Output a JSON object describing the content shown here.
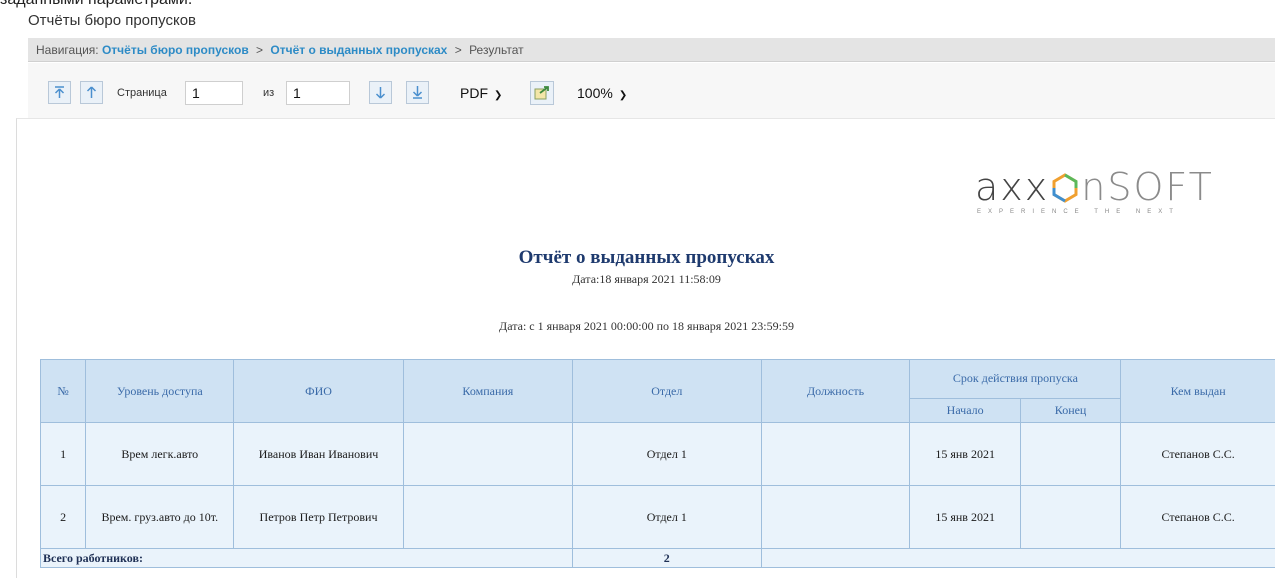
{
  "top_text": "заданными параметрами.",
  "window_title": "Отчёты бюро пропусков",
  "breadcrumb": {
    "prefix": "Навигация:",
    "items": [
      "Отчёты бюро пропусков",
      "Отчёт о выданных пропусках"
    ],
    "separator": ">",
    "current": "Результат"
  },
  "toolbar": {
    "page_label": "Страница",
    "page_value": "1",
    "of_label": "из",
    "total_pages": "1",
    "format": "PDF",
    "zoom": "100%"
  },
  "logo": {
    "brand": "axxonsoft",
    "text_part1": "axx",
    "text_part2": "nSOFT",
    "tagline": "EXPERIENCE THE NEXT"
  },
  "report": {
    "title": "Отчёт о выданных пропусках",
    "date_line": "Дата:18 января 2021 11:58:09",
    "period_line": "Дата: с 1 января 2021 00:00:00 по 18 января 2021 23:59:59",
    "columns": {
      "num": "№",
      "access_level": "Уровень доступа",
      "fio": "ФИО",
      "company": "Компания",
      "department": "Отдел",
      "position": "Должность",
      "validity": "Срок действия пропуска",
      "start": "Начало",
      "end": "Конец",
      "issued_by": "Кем выдан"
    },
    "rows": [
      {
        "num": "1",
        "access_level": "Врем легк.авто",
        "fio": "Иванов Иван Иванович",
        "company": "",
        "department": "Отдел 1",
        "position": "",
        "start": "15 янв 2021",
        "end": "",
        "issued_by": "Степанов С.С."
      },
      {
        "num": "2",
        "access_level": "Врем. груз.авто до 10т.",
        "fio": "Петров Петр Петрович",
        "company": "",
        "department": "Отдел 1",
        "position": "",
        "start": "15 янв 2021",
        "end": "",
        "issued_by": "Степанов С.С."
      }
    ],
    "total_label": "Всего работников:",
    "total_value": "2"
  },
  "colors": {
    "link": "#2d8bc6",
    "header_bg": "#cfe2f3",
    "header_text": "#3a6aa8",
    "cell_bg": "#eaf3fb",
    "title": "#1e3a6e",
    "logo_accent": "#f0a030"
  }
}
